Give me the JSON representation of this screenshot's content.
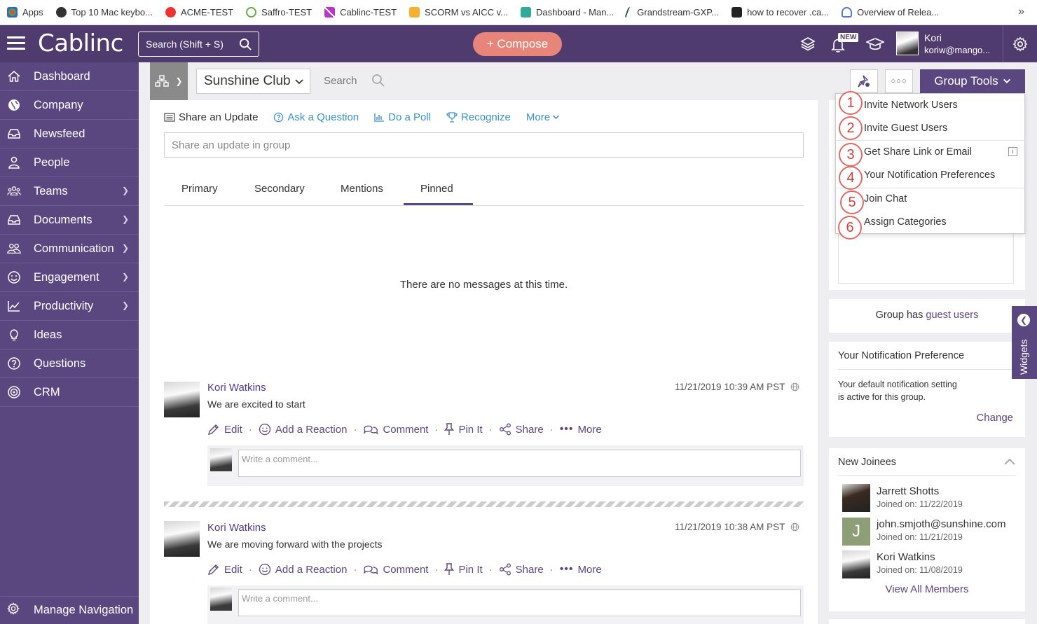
{
  "bookmarks": [
    {
      "label": "Apps",
      "color": "#d44"
    },
    {
      "label": "Top 10 Mac keybo...",
      "color": "#333"
    },
    {
      "label": "ACME-TEST",
      "color": "#e33"
    },
    {
      "label": "Saffro-TEST",
      "color": "#6a4"
    },
    {
      "label": "Cablinc-TEST",
      "color": "#b3c"
    },
    {
      "label": "SCORM vs AICC v...",
      "color": "#f5b030"
    },
    {
      "label": "Dashboard - Man...",
      "color": "#3a9"
    },
    {
      "label": "Grandstream-GXP...",
      "color": "#246"
    },
    {
      "label": "how to recover .ca...",
      "color": "#222"
    },
    {
      "label": "Overview of Relea...",
      "color": "#57c"
    }
  ],
  "header": {
    "logo": "Cablinc",
    "search_placeholder": "Search (Shift + S)",
    "compose_label": "+ Compose",
    "new_badge": "NEW",
    "user_name": "Kori",
    "user_email": "koriw@mango..."
  },
  "sidebar": {
    "items": [
      {
        "label": "Dashboard",
        "icon": "home-icon",
        "chevron": false
      },
      {
        "label": "Company",
        "icon": "globe-icon",
        "chevron": false
      },
      {
        "label": "Newsfeed",
        "icon": "inbox-icon",
        "chevron": false
      },
      {
        "label": "People",
        "icon": "person-icon",
        "chevron": false
      },
      {
        "label": "Teams",
        "icon": "teams-icon",
        "chevron": true
      },
      {
        "label": "Documents",
        "icon": "tray-icon",
        "chevron": true
      },
      {
        "label": "Communication",
        "icon": "group-icon",
        "chevron": true
      },
      {
        "label": "Engagement",
        "icon": "smile-icon",
        "chevron": true
      },
      {
        "label": "Productivity",
        "icon": "chart-icon",
        "chevron": true
      },
      {
        "label": "Ideas",
        "icon": "bulb-icon",
        "chevron": false
      },
      {
        "label": "Questions",
        "icon": "question-icon",
        "chevron": false
      },
      {
        "label": "CRM",
        "icon": "target-icon",
        "chevron": false
      }
    ],
    "manage_navigation": "Manage Navigation"
  },
  "group_bar": {
    "group_name": "Sunshine Club",
    "search_label": "Search",
    "group_tools_label": "Group Tools"
  },
  "composer": {
    "actions": [
      "Share an Update",
      "Ask a Question",
      "Do a Poll",
      "Recognize",
      "More"
    ],
    "placeholder": "Share an update in group"
  },
  "feed_tabs": [
    "Primary",
    "Secondary",
    "Mentions",
    "Pinned"
  ],
  "active_tab": "Pinned",
  "empty_message": "There are no messages at this time.",
  "posts": [
    {
      "author": "Kori Watkins",
      "text": "We are excited to start",
      "time": "11/21/2019 10:39 AM PST"
    },
    {
      "author": "Kori Watkins",
      "text": "We are moving forward with the projects",
      "time": "11/21/2019 10:38 AM PST"
    }
  ],
  "post_actions": [
    "Edit",
    "Add a Reaction",
    "Comment",
    "Pin It",
    "Share",
    "More"
  ],
  "comment_placeholder": "Write a comment...",
  "group_tools_menu": {
    "items": [
      "Invite Network Users",
      "Invite Guest Users",
      "Get Share Link or Email",
      "Your Notification Preferences",
      "Join Chat",
      "Assign Categories"
    ],
    "callouts": [
      "1",
      "2",
      "3",
      "4",
      "5",
      "6"
    ],
    "info_badge": "i"
  },
  "guest_users": {
    "prefix": "Group has",
    "link": "guest users"
  },
  "widgets_label": "Widgets",
  "notification_pref": {
    "title": "Your Notification Preference",
    "body_line1": "Your default notification setting",
    "body_line2": "is active for this group.",
    "change_label": "Change"
  },
  "new_joinees": {
    "title": "New Joinees",
    "members": [
      {
        "name": "Jarrett Shotts",
        "joined": "Joined on: 11/22/2019"
      },
      {
        "name": "john.smjoth@sunshine.com",
        "joined": "Joined on: 11/21/2019",
        "initial": "J"
      },
      {
        "name": "Kori Watkins",
        "joined": "Joined on: 11/08/2019"
      }
    ],
    "view_all": "View All Members"
  },
  "colors": {
    "brand_purple": "#5b4780",
    "header_purple": "#4f3b6e",
    "compose": "#e8857a",
    "link_blue": "#3a8fd0",
    "callout_red": "#e26a63"
  }
}
